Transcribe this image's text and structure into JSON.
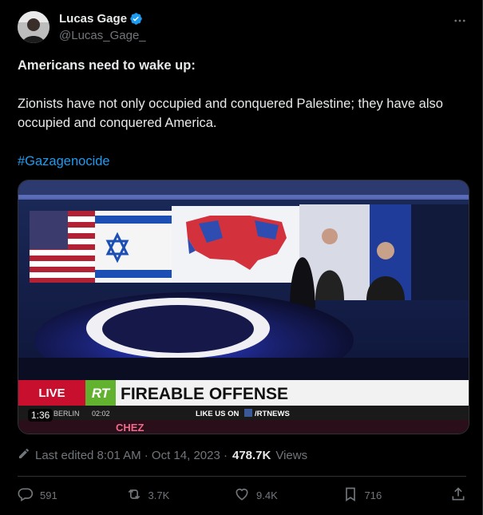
{
  "author": {
    "display_name": "Lucas Gage",
    "handle": "@Lucas_Gage_",
    "verified": true
  },
  "tweet": {
    "line1": "Americans need to wake up:",
    "line2": "Zionists have not only occupied and conquered Palestine; they have also occupied and conquered America.",
    "hashtag": "#Gazagenocide"
  },
  "video": {
    "duration": "1:36",
    "banner_live": "LIVE",
    "banner_logo": "RT",
    "banner_headline": "FIREABLE OFFENSE",
    "ticker_city": "BERLIN",
    "ticker_time": "02:02",
    "ticker_like": "LIKE US ON",
    "ticker_handle": "/RTNEWS",
    "desk_text": "CHEZ"
  },
  "meta": {
    "edited": "Last edited 8:01 AM · Oct 14, 2023 ·",
    "views_count": "478.7K",
    "views_label": "Views"
  },
  "actions": {
    "replies": "591",
    "reposts": "3.7K",
    "likes": "9.4K",
    "bookmarks": "716"
  },
  "colors": {
    "accent": "#1d9bf0",
    "muted": "#71767b",
    "text": "#e7e9ea"
  }
}
